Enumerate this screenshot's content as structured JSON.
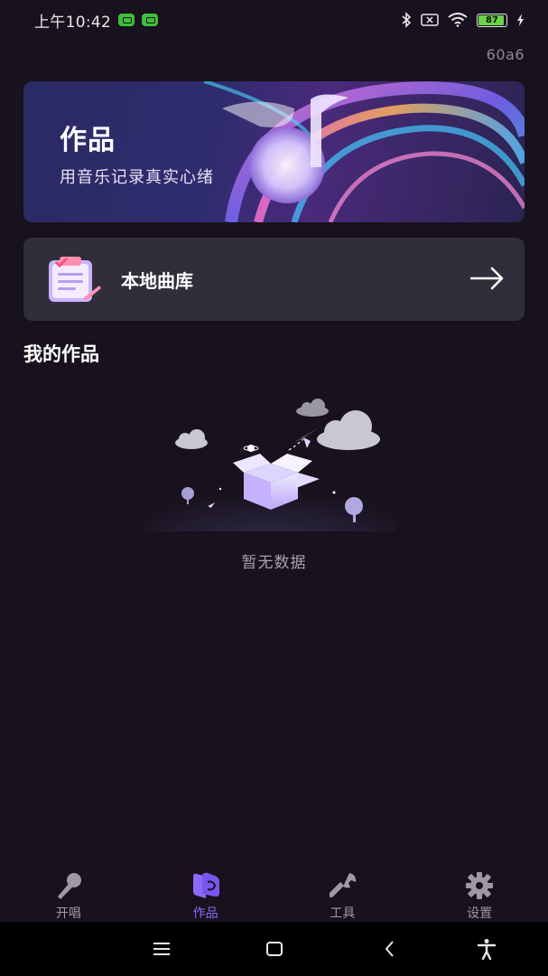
{
  "status_bar": {
    "time": "上午10:42",
    "battery": "87",
    "battery_level": 0.87
  },
  "version": "60a6",
  "banner": {
    "title": "作品",
    "subtitle": "用音乐记录真实心绪"
  },
  "library": {
    "label": "本地曲库"
  },
  "section": {
    "title": "我的作品"
  },
  "empty_state": {
    "text": "暂无数据"
  },
  "tabs": [
    {
      "label": "开唱",
      "icon": "microphone-icon",
      "active": false
    },
    {
      "label": "作品",
      "icon": "works-icon",
      "active": true
    },
    {
      "label": "工具",
      "icon": "wrench-icon",
      "active": false
    },
    {
      "label": "设置",
      "icon": "gear-icon",
      "active": false
    }
  ],
  "colors": {
    "background": "#17121d",
    "card": "#302e3a",
    "accent": "#8c6bff",
    "tab_inactive": "#9d99a5"
  }
}
